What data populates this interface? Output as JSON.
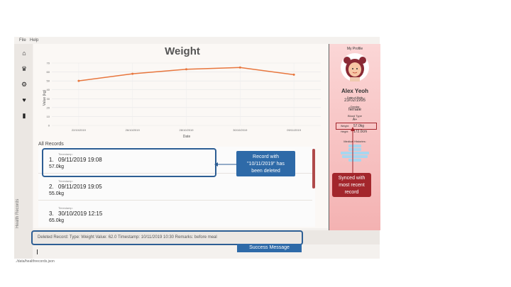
{
  "menu": [
    "File",
    "Help"
  ],
  "sidebar": {
    "icons": [
      "home-icon",
      "food-icon",
      "recipe-icon",
      "health-icon",
      "diary-icon"
    ],
    "vertical_label": "Health Records"
  },
  "chart_data": {
    "type": "line",
    "title": "Weight",
    "xlabel": "Date",
    "ylabel": "Value (kg)",
    "x": [
      "22/10/2019",
      "26/10/2019",
      "28/10/2019",
      "30/10/2019",
      "09/11/2019"
    ],
    "values": [
      50,
      58,
      63,
      65,
      57
    ],
    "ylim": [
      0,
      70
    ],
    "yticks": [
      0,
      10,
      20,
      30,
      40,
      50,
      60,
      70
    ],
    "color": "#e8763d",
    "grid": true
  },
  "records": {
    "title": "All Records",
    "items": [
      {
        "index": "1.",
        "ts_label": "Timestamp:",
        "date": "09/11/2019 19:08",
        "value": "57.0kg"
      },
      {
        "index": "2.",
        "ts_label": "Timestamp:",
        "date": "09/11/2019 19:05",
        "value": "55.0kg"
      },
      {
        "index": "3.",
        "ts_label": "Timestamp:",
        "date": "30/10/2019 12:15",
        "value": "65.0kg"
      }
    ]
  },
  "profile": {
    "heading": "My Profile",
    "name": "Alex Yeoh",
    "dob_label": "Date of Birth",
    "dob": "23/02/1995",
    "gender_label": "Gender",
    "gender": "female",
    "blood_label": "Blood Type",
    "blood": "A+",
    "weight_label": "Weight:",
    "weight": "57.0kg",
    "height_label": "Height:",
    "height": "172.0cm",
    "medical_label": "Medical Histories:"
  },
  "annotations": {
    "deleted_note": "Record with \"10/11/2019\" has been deleted",
    "synced_note": "Synced with most recent record",
    "success_note": "Success Message"
  },
  "result": "Deleted Record: Type: Weight Value: 62.0 Timestamp: 10/11/2019 10:30 Remarks: before meal",
  "footer": "./data/healthrecords.json",
  "colors": {
    "accent": "#2d5e94",
    "alert": "#a3262c",
    "line": "#e8763d"
  }
}
